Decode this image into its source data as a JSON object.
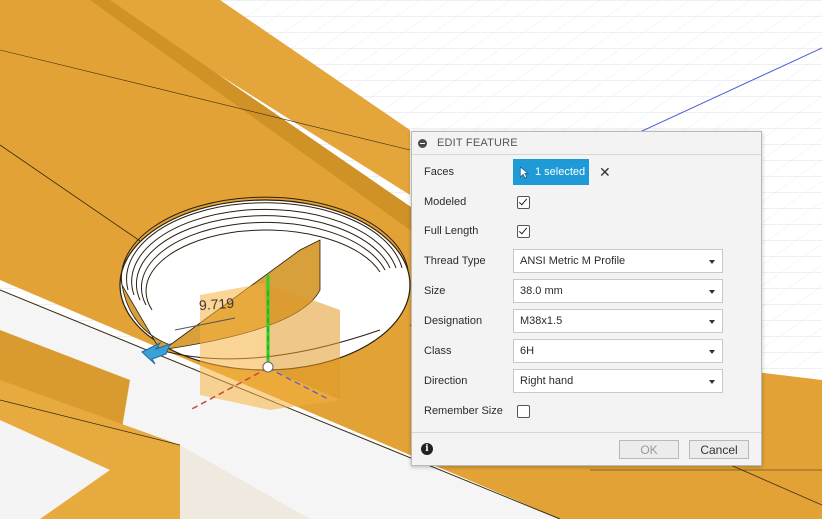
{
  "viewport": {
    "dimension_value": "9.719",
    "colors": {
      "body": "#e2a236",
      "body_dark": "#c68820",
      "grid_line": "#d8dde6",
      "axis_blue": "#4a5fd8",
      "axis_green": "#2ad12a",
      "axis_red": "#c44a4a",
      "manipulator": "#f2b74a"
    }
  },
  "dialog": {
    "title": "EDIT FEATURE",
    "faces": {
      "label": "Faces",
      "button_label": "1 selected"
    },
    "modeled": {
      "label": "Modeled",
      "checked": true
    },
    "full_length": {
      "label": "Full Length",
      "checked": true
    },
    "thread_type": {
      "label": "Thread Type",
      "value": "ANSI Metric M Profile"
    },
    "size": {
      "label": "Size",
      "value": "38.0 mm"
    },
    "designation": {
      "label": "Designation",
      "value": "M38x1.5"
    },
    "class": {
      "label": "Class",
      "value": "6H"
    },
    "direction": {
      "label": "Direction",
      "value": "Right hand"
    },
    "remember_size": {
      "label": "Remember Size",
      "checked": false
    },
    "ok_label": "OK",
    "cancel_label": "Cancel",
    "accent_color": "#1e9ad6"
  }
}
